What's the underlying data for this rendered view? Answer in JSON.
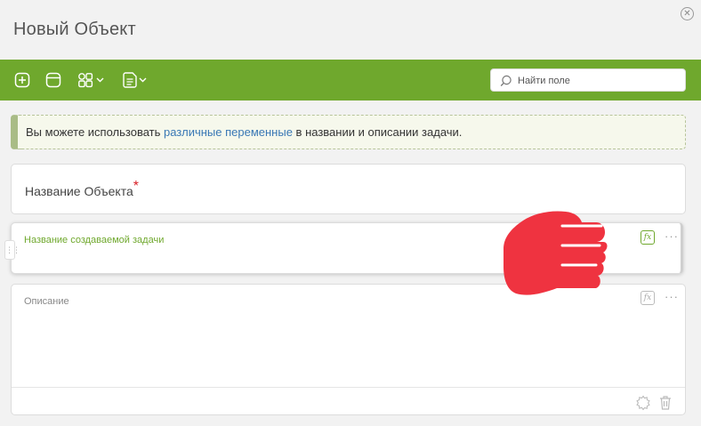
{
  "window": {
    "title": "Новый Объект",
    "close_glyph": "⊗"
  },
  "toolbar": {
    "icons": [
      "add-icon",
      "panel-icon",
      "components-icon",
      "document-list-icon"
    ],
    "search_placeholder": "Найти поле"
  },
  "info": {
    "text_before": "Вы можете использовать ",
    "link": "различные переменные",
    "text_after": " в названии и описании задачи."
  },
  "fields": {
    "name": {
      "label": "Название Объекта",
      "required_mark": "*"
    },
    "task_name": {
      "label": "Название создаваемой задачи",
      "fx": "fx",
      "more": "···"
    },
    "description": {
      "label": "Описание",
      "fx": "fx",
      "more": "···"
    }
  },
  "colors": {
    "accent": "#6fa82d",
    "link": "#3a78b5",
    "required": "#d81f26",
    "pointer_hand": "#ef3340"
  }
}
